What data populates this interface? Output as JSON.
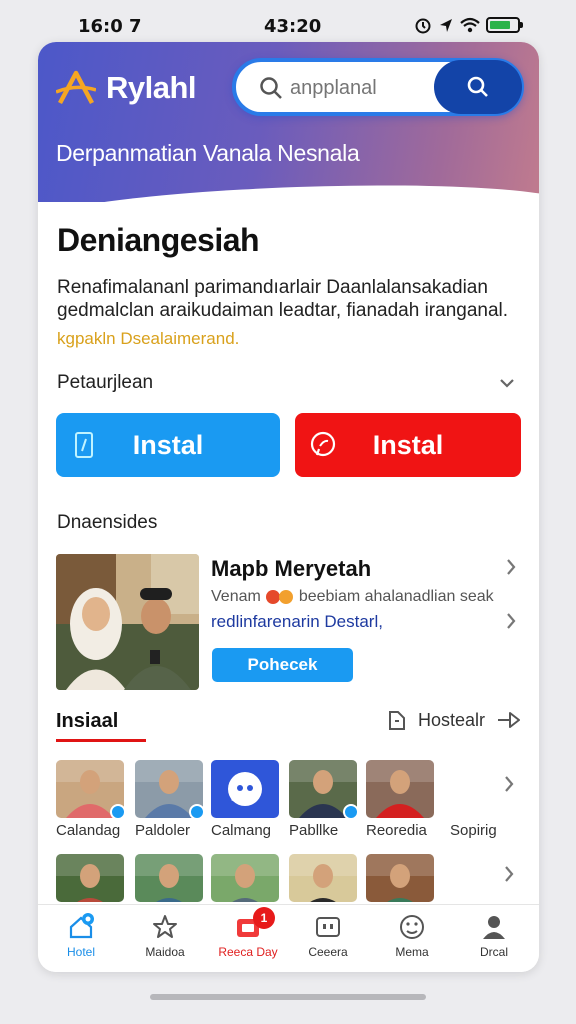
{
  "status_bar": {
    "time_left": "16:0 7",
    "time_center": "43:20",
    "battery_level": 0.75,
    "battery_color": "#2db34a"
  },
  "header": {
    "app_name": "Rylahl",
    "search_placeholder": "anpplanal",
    "subtitle": "Derpanmatian Vanala Nesnala"
  },
  "main": {
    "title": "Deniangesiah",
    "description": "Renafimalananl parimandıarlair Daanlalansakadian gedmalclan araikudaiman leadtar, fianadah iranganal.",
    "link": "kgpakln Dsealaimerand.",
    "dropdown_label": "Petaurjlean",
    "install_buttons": [
      {
        "label": "Instal",
        "color": "#1a9af2",
        "icon": "file-icon"
      },
      {
        "label": "Instal",
        "color": "#f01414",
        "icon": "chat-icon"
      }
    ]
  },
  "section": {
    "title": "Dnaensides",
    "card": {
      "title": "Mapb Meryetah",
      "line1": "Venam",
      "line1_rest": "beebiam ahalanadlian seak",
      "line2": "redlinfarenarin Destarl,",
      "button": "Pohecek"
    }
  },
  "tabs": {
    "active": "Insiaal",
    "secondary": "Hostealr"
  },
  "grid": {
    "row1": [
      {
        "label": "Calandag",
        "badge": true,
        "bg": "#c9a680",
        "shirt": "#e06a6a"
      },
      {
        "label": "Paldoler",
        "badge": true,
        "bg": "#8c9ba8",
        "shirt": "#5a7aa8"
      },
      {
        "label": "Calmang",
        "badge": false,
        "app_icon": true
      },
      {
        "label": "Pabllke",
        "badge": true,
        "bg": "#5a6a4a",
        "shirt": "#2a3550"
      },
      {
        "label": "Reoredia",
        "badge": false,
        "bg": "#8a6a5a",
        "shirt": "#d42020"
      },
      {
        "label": "Sopirig",
        "badge": false,
        "empty": true
      }
    ],
    "row2": [
      {
        "bg": "#4a6a3a",
        "shirt": "#b84a3a"
      },
      {
        "bg": "#5a8a5a",
        "shirt": "#3a6a8a"
      },
      {
        "bg": "#7aa86a",
        "shirt": "#556b7a"
      },
      {
        "bg": "#d8c99a",
        "shirt": "#2a2a2a"
      },
      {
        "bg": "#8a5a3a",
        "shirt": "#3a7a5a"
      }
    ]
  },
  "nav": [
    {
      "label": "Hotel",
      "icon": "home-icon",
      "active": true
    },
    {
      "label": "Maidoa",
      "icon": "star-icon"
    },
    {
      "label": "Reeca Day",
      "icon": "inbox-icon",
      "badge": "1",
      "red": true
    },
    {
      "label": "Ceeera",
      "icon": "tray-icon"
    },
    {
      "label": "Mema",
      "icon": "emoji-icon"
    },
    {
      "label": "Drcal",
      "icon": "profile-icon"
    }
  ]
}
